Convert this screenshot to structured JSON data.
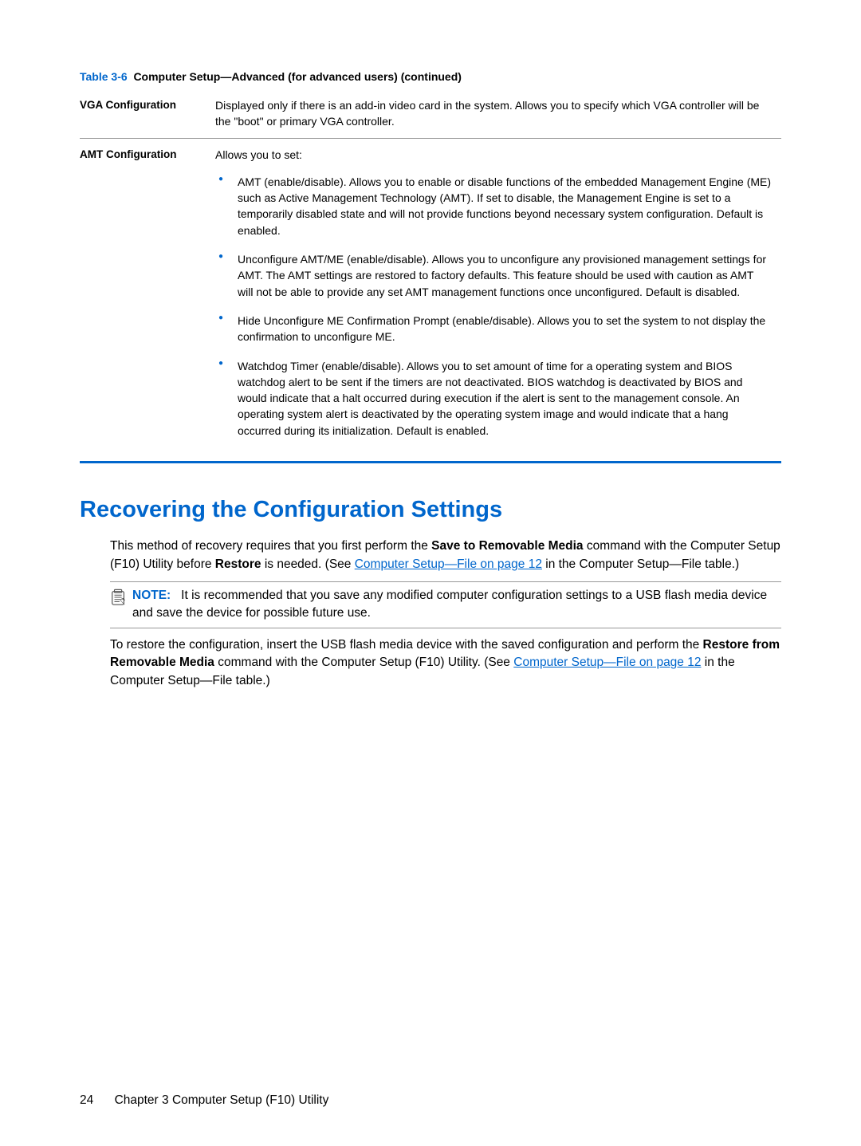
{
  "table": {
    "caption_number": "Table 3-6",
    "caption_title": "Computer Setup—Advanced (for advanced users) (continued)",
    "rows": [
      {
        "label": "VGA Configuration",
        "intro": "Displayed only if there is an add-in video card in the system. Allows you to specify which VGA controller will be the \"boot\" or primary VGA controller.",
        "bullets": []
      },
      {
        "label": "AMT Configuration",
        "intro": "Allows you to set:",
        "bullets": [
          "AMT (enable/disable). Allows you to enable or disable functions of the embedded Management Engine (ME) such as Active Management Technology (AMT). If set to disable, the Management Engine is set to a temporarily disabled state and will not provide functions beyond necessary system configuration. Default is enabled.",
          "Unconfigure AMT/ME (enable/disable). Allows you to unconfigure any provisioned management settings for AMT. The AMT settings are restored to factory defaults. This feature should be used with caution as AMT will not be able to provide any set AMT management functions once unconfigured. Default is disabled.",
          "Hide Unconfigure ME Confirmation Prompt (enable/disable). Allows you to set the system to not display the confirmation to unconfigure ME.",
          "Watchdog Timer (enable/disable). Allows you to set amount of time for a operating system and BIOS watchdog alert to be sent if the timers are not deactivated. BIOS watchdog is deactivated by BIOS and would indicate that a halt occurred during execution if the alert is sent to the management console. An operating system alert is deactivated by the operating system image and would indicate that a hang occurred during its initialization. Default is enabled."
        ]
      }
    ]
  },
  "section": {
    "title": "Recovering the Configuration Settings",
    "para1_a": "This method of recovery requires that you first perform the ",
    "para1_b_bold": "Save to Removable Media",
    "para1_c": " command with the Computer Setup (F10) Utility before ",
    "para1_d_bold": "Restore",
    "para1_e": " is needed. (See ",
    "para1_link": "Computer Setup—File on page 12",
    "para1_f": " in the Computer Setup—File table.)",
    "note_label": "NOTE:",
    "note_text": "It is recommended that you save any modified computer configuration settings to a USB flash media device and save the device for possible future use.",
    "para2_a": "To restore the configuration, insert the USB flash media device with the saved configuration and perform the ",
    "para2_b_bold": "Restore from Removable Media",
    "para2_c": " command with the Computer Setup (F10) Utility. (See ",
    "para2_link": "Computer Setup—File on page 12",
    "para2_d": " in the Computer Setup—File table.)"
  },
  "footer": {
    "page": "24",
    "chapter": "Chapter 3   Computer Setup (F10) Utility"
  }
}
